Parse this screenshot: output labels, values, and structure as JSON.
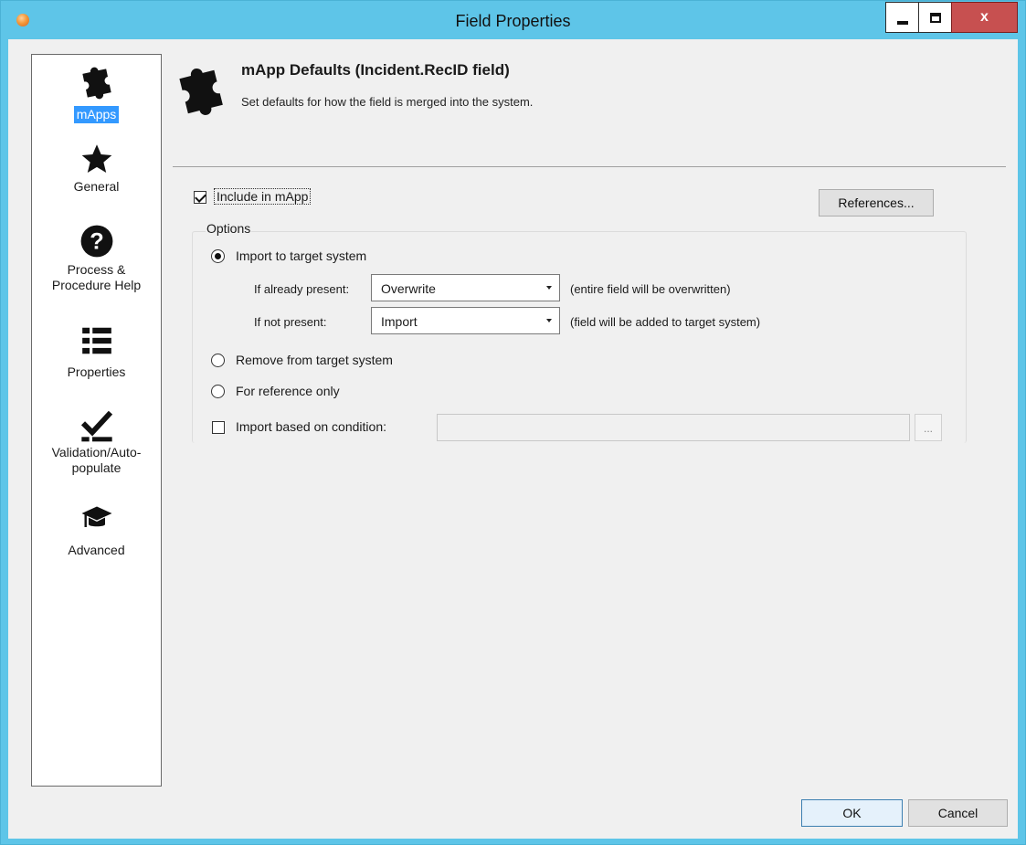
{
  "window": {
    "title": "Field Properties",
    "close_glyph": "x"
  },
  "nav": {
    "items": [
      {
        "label": "mApps",
        "icon": "puzzle-icon",
        "selected": true
      },
      {
        "label": "General",
        "icon": "star-icon"
      },
      {
        "label": "Process &",
        "label2": "Procedure Help",
        "icon": "help-icon"
      },
      {
        "label": "Properties",
        "icon": "list-icon"
      },
      {
        "label": "Validation/Auto-",
        "label2": "populate",
        "icon": "check-icon"
      },
      {
        "label": "Advanced",
        "icon": "graduation-cap-icon"
      }
    ]
  },
  "header": {
    "title": "mApp Defaults (Incident.RecID field)",
    "subtitle": "Set defaults for how the field is merged into the system."
  },
  "form": {
    "include_label": "Include in mApp",
    "include_checked": true,
    "references_button": "References...",
    "options_legend": "Options",
    "radio_import": "Import to target system",
    "if_present_label": "If already present:",
    "if_present_value": "Overwrite",
    "if_present_note": "(entire field will be overwritten)",
    "if_not_present_label": "If not present:",
    "if_not_present_value": "Import",
    "if_not_present_note": "(field will be added to target system)",
    "radio_remove": "Remove from target system",
    "radio_reference": "For reference only",
    "condition_label": "Import based on condition:",
    "condition_value": "",
    "ellipsis": "..."
  },
  "footer": {
    "ok": "OK",
    "cancel": "Cancel"
  },
  "colors": {
    "title_bar": "#5ec5e8",
    "selection": "#3399ff",
    "close_button": "#c75050"
  }
}
